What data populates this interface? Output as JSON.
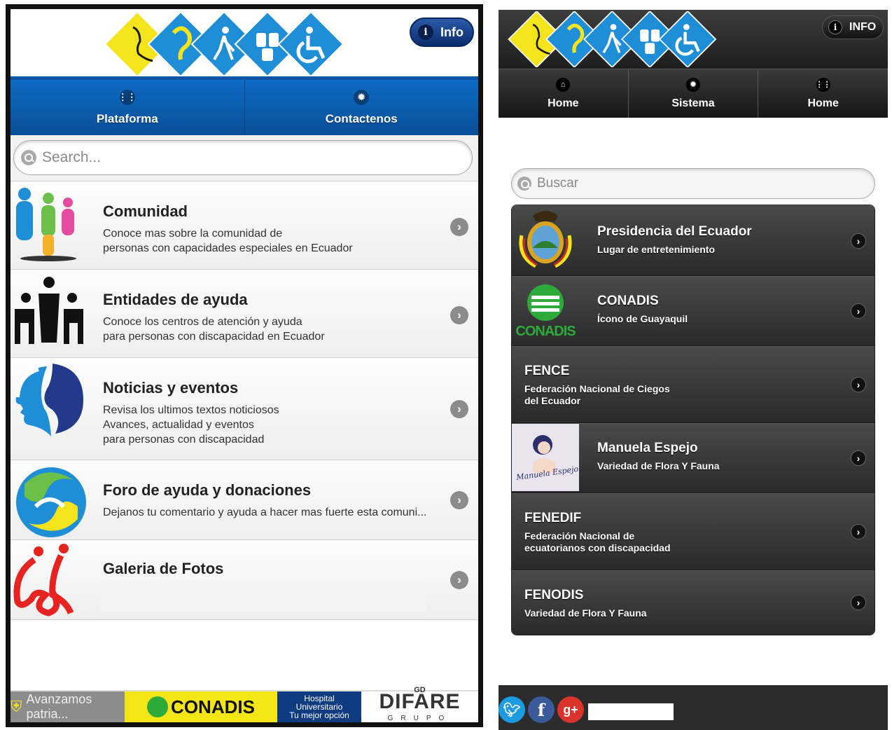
{
  "left": {
    "info_label": "Info",
    "nav": [
      {
        "label": "Plataforma",
        "icon": "grid-icon"
      },
      {
        "label": "Contactenos",
        "icon": "gear-icon"
      }
    ],
    "search_placeholder": "Search...",
    "items": [
      {
        "title": "Comunidad",
        "lines": [
          "Conoce mas sobre la comunidad de",
          "personas con capacidades especiales en Ecuador"
        ]
      },
      {
        "title": "Entidades de ayuda",
        "lines": [
          "Conoce los centros de atención y ayuda",
          "para personas con discapacidad en Ecuador"
        ]
      },
      {
        "title": "Noticias y eventos",
        "lines": [
          "Revisa los ultimos textos noticiosos",
          "Avances, actualidad y eventos",
          "para personas con discapacidad"
        ]
      },
      {
        "title": "Foro de ayuda y donaciones",
        "lines": [
          "Dejanos tu comentario y ayuda a hacer mas fuerte esta comuni..."
        ]
      },
      {
        "title": "Galeria de Fotos",
        "lines": []
      }
    ],
    "footer": {
      "banner1": "Avanzamos patria...",
      "banner2": "CONADIS",
      "banner3_lines": [
        "Hospital",
        "Universitario",
        "Tu mejor opción"
      ],
      "banner4_top": "GD",
      "banner4": "DIFARE",
      "banner4_sub": "GRUPO"
    }
  },
  "right": {
    "info_label": "INFO",
    "nav": [
      {
        "label": "Home",
        "icon": "home-icon"
      },
      {
        "label": "Sistema",
        "icon": "gear-icon"
      },
      {
        "label": "Home",
        "icon": "grid-icon"
      }
    ],
    "search_placeholder": "Buscar",
    "items": [
      {
        "title": "Presidencia del Ecuador",
        "lines": [
          "Lugar de entretenimiento"
        ]
      },
      {
        "title": "CONADIS",
        "lines": [
          "Ícono de Guayaquil"
        ],
        "logo_text": "CONADIS"
      },
      {
        "title": "FENCE",
        "lines": [
          "Federación Nacional de Ciegos",
          "del Ecuador"
        ]
      },
      {
        "title": "Manuela Espejo",
        "lines": [
          "Variedad de Flora Y Fauna"
        ],
        "logo_text": "Manuela Espejo"
      },
      {
        "title": "FENEDIF",
        "lines": [
          "Federación Nacional de",
          "ecuatorianos con discapacidad"
        ]
      },
      {
        "title": "FENODIS",
        "lines": [
          "Variedad de Flora Y Fauna"
        ]
      }
    ]
  },
  "colors": {
    "left_nav_blue": "#0a55a6",
    "logo_blue": "#1f8ed6",
    "logo_yellow": "#f5e41c",
    "right_bar_dark": "#2a2a2a"
  }
}
